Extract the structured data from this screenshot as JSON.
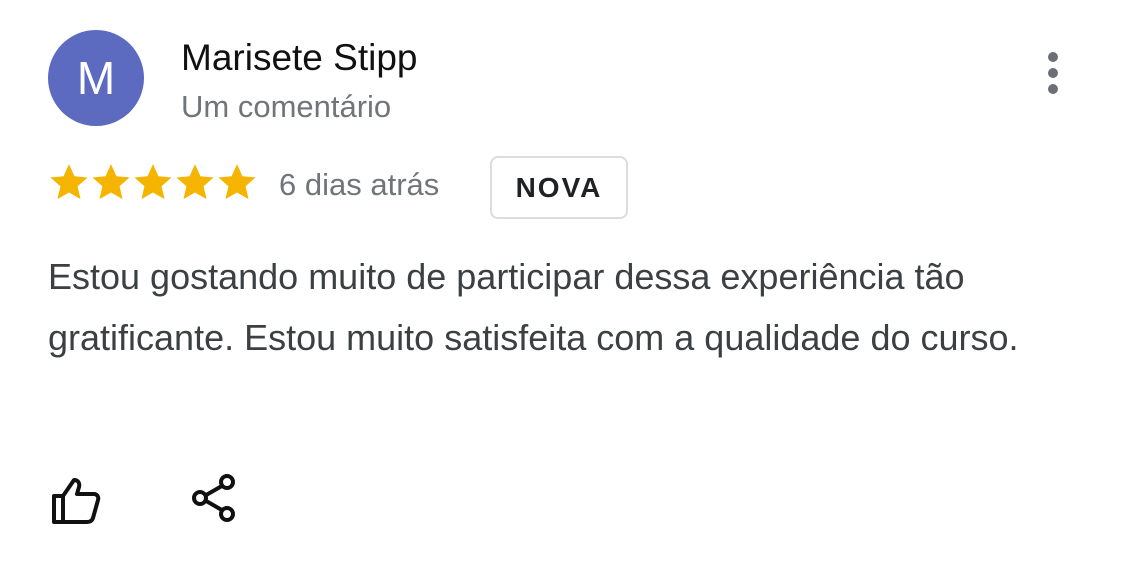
{
  "review": {
    "avatar_letter": "M",
    "avatar_color": "#5c6bc0",
    "author_name": "Marisete Stipp",
    "author_meta": "Um comentário",
    "rating": 5,
    "rating_max": 5,
    "star_color": "#f4b400",
    "date": "6 dias atrás",
    "badge": "NOVA",
    "text": "Estou gostando muito de participar dessa experiência tão gratificante. Estou muito satisfeita com a qualidade do curso."
  },
  "actions": {
    "menu_icon": "more-vert-icon",
    "like_icon": "thumb-up-icon",
    "share_icon": "share-icon"
  }
}
